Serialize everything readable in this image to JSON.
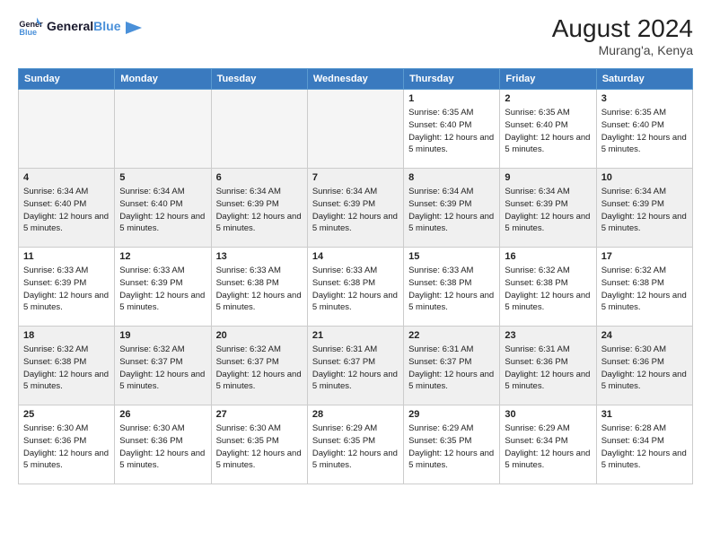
{
  "header": {
    "logo_general": "General",
    "logo_blue": "Blue",
    "month_year": "August 2024",
    "location": "Murang'a, Kenya"
  },
  "weekdays": [
    "Sunday",
    "Monday",
    "Tuesday",
    "Wednesday",
    "Thursday",
    "Friday",
    "Saturday"
  ],
  "weeks": [
    [
      {
        "day": "",
        "empty": true
      },
      {
        "day": "",
        "empty": true
      },
      {
        "day": "",
        "empty": true
      },
      {
        "day": "",
        "empty": true
      },
      {
        "day": "1",
        "sunrise": "6:35 AM",
        "sunset": "6:40 PM",
        "daylight": "12 hours and 5 minutes."
      },
      {
        "day": "2",
        "sunrise": "6:35 AM",
        "sunset": "6:40 PM",
        "daylight": "12 hours and 5 minutes."
      },
      {
        "day": "3",
        "sunrise": "6:35 AM",
        "sunset": "6:40 PM",
        "daylight": "12 hours and 5 minutes."
      }
    ],
    [
      {
        "day": "4",
        "sunrise": "6:34 AM",
        "sunset": "6:40 PM",
        "daylight": "12 hours and 5 minutes."
      },
      {
        "day": "5",
        "sunrise": "6:34 AM",
        "sunset": "6:40 PM",
        "daylight": "12 hours and 5 minutes."
      },
      {
        "day": "6",
        "sunrise": "6:34 AM",
        "sunset": "6:39 PM",
        "daylight": "12 hours and 5 minutes."
      },
      {
        "day": "7",
        "sunrise": "6:34 AM",
        "sunset": "6:39 PM",
        "daylight": "12 hours and 5 minutes."
      },
      {
        "day": "8",
        "sunrise": "6:34 AM",
        "sunset": "6:39 PM",
        "daylight": "12 hours and 5 minutes."
      },
      {
        "day": "9",
        "sunrise": "6:34 AM",
        "sunset": "6:39 PM",
        "daylight": "12 hours and 5 minutes."
      },
      {
        "day": "10",
        "sunrise": "6:34 AM",
        "sunset": "6:39 PM",
        "daylight": "12 hours and 5 minutes."
      }
    ],
    [
      {
        "day": "11",
        "sunrise": "6:33 AM",
        "sunset": "6:39 PM",
        "daylight": "12 hours and 5 minutes."
      },
      {
        "day": "12",
        "sunrise": "6:33 AM",
        "sunset": "6:39 PM",
        "daylight": "12 hours and 5 minutes."
      },
      {
        "day": "13",
        "sunrise": "6:33 AM",
        "sunset": "6:38 PM",
        "daylight": "12 hours and 5 minutes."
      },
      {
        "day": "14",
        "sunrise": "6:33 AM",
        "sunset": "6:38 PM",
        "daylight": "12 hours and 5 minutes."
      },
      {
        "day": "15",
        "sunrise": "6:33 AM",
        "sunset": "6:38 PM",
        "daylight": "12 hours and 5 minutes."
      },
      {
        "day": "16",
        "sunrise": "6:32 AM",
        "sunset": "6:38 PM",
        "daylight": "12 hours and 5 minutes."
      },
      {
        "day": "17",
        "sunrise": "6:32 AM",
        "sunset": "6:38 PM",
        "daylight": "12 hours and 5 minutes."
      }
    ],
    [
      {
        "day": "18",
        "sunrise": "6:32 AM",
        "sunset": "6:38 PM",
        "daylight": "12 hours and 5 minutes."
      },
      {
        "day": "19",
        "sunrise": "6:32 AM",
        "sunset": "6:37 PM",
        "daylight": "12 hours and 5 minutes."
      },
      {
        "day": "20",
        "sunrise": "6:32 AM",
        "sunset": "6:37 PM",
        "daylight": "12 hours and 5 minutes."
      },
      {
        "day": "21",
        "sunrise": "6:31 AM",
        "sunset": "6:37 PM",
        "daylight": "12 hours and 5 minutes."
      },
      {
        "day": "22",
        "sunrise": "6:31 AM",
        "sunset": "6:37 PM",
        "daylight": "12 hours and 5 minutes."
      },
      {
        "day": "23",
        "sunrise": "6:31 AM",
        "sunset": "6:36 PM",
        "daylight": "12 hours and 5 minutes."
      },
      {
        "day": "24",
        "sunrise": "6:30 AM",
        "sunset": "6:36 PM",
        "daylight": "12 hours and 5 minutes."
      }
    ],
    [
      {
        "day": "25",
        "sunrise": "6:30 AM",
        "sunset": "6:36 PM",
        "daylight": "12 hours and 5 minutes."
      },
      {
        "day": "26",
        "sunrise": "6:30 AM",
        "sunset": "6:36 PM",
        "daylight": "12 hours and 5 minutes."
      },
      {
        "day": "27",
        "sunrise": "6:30 AM",
        "sunset": "6:35 PM",
        "daylight": "12 hours and 5 minutes."
      },
      {
        "day": "28",
        "sunrise": "6:29 AM",
        "sunset": "6:35 PM",
        "daylight": "12 hours and 5 minutes."
      },
      {
        "day": "29",
        "sunrise": "6:29 AM",
        "sunset": "6:35 PM",
        "daylight": "12 hours and 5 minutes."
      },
      {
        "day": "30",
        "sunrise": "6:29 AM",
        "sunset": "6:34 PM",
        "daylight": "12 hours and 5 minutes."
      },
      {
        "day": "31",
        "sunrise": "6:28 AM",
        "sunset": "6:34 PM",
        "daylight": "12 hours and 5 minutes."
      }
    ]
  ]
}
